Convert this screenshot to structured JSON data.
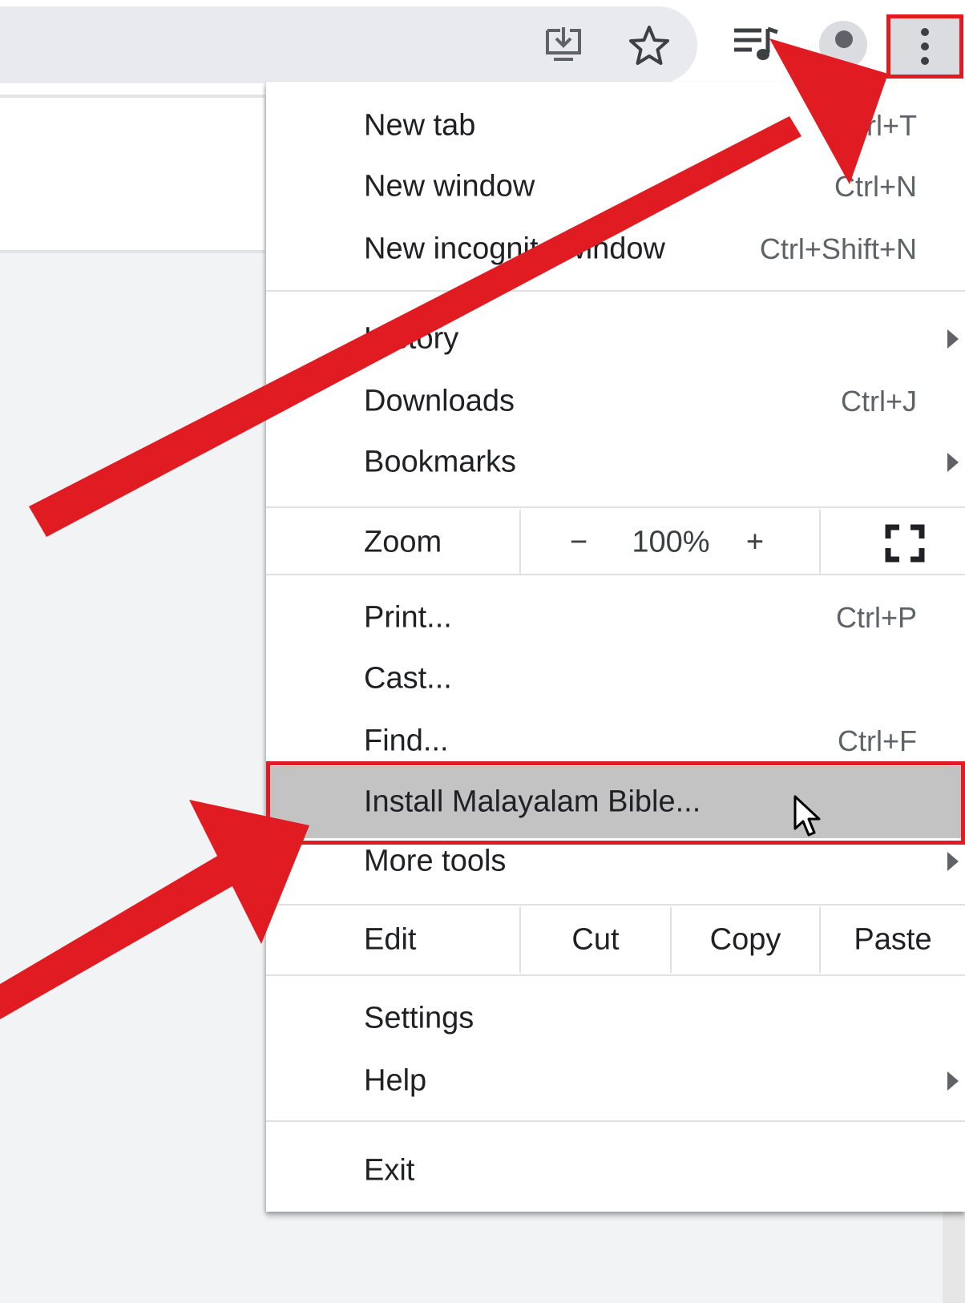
{
  "toolbar": {
    "icons": [
      "install-app-icon",
      "bookmark-star-icon",
      "media-controls-icon",
      "avatar",
      "kebab-menu-icon"
    ]
  },
  "menu": {
    "items": [
      {
        "label": "New tab",
        "shortcut": "Ctrl+T"
      },
      {
        "label": "New window",
        "shortcut": "Ctrl+N"
      },
      {
        "label": "New incognito window",
        "shortcut": "Ctrl+Shift+N"
      },
      {
        "label": "History",
        "submenu": true
      },
      {
        "label": "Downloads",
        "shortcut": "Ctrl+J"
      },
      {
        "label": "Bookmarks",
        "submenu": true
      },
      {
        "label": "Print...",
        "shortcut": "Ctrl+P"
      },
      {
        "label": "Cast..."
      },
      {
        "label": "Find...",
        "shortcut": "Ctrl+F"
      },
      {
        "label": "Install Malayalam Bible...",
        "highlighted": true
      },
      {
        "label": "More tools",
        "submenu": true
      },
      {
        "label": "Settings"
      },
      {
        "label": "Help",
        "submenu": true
      },
      {
        "label": "Exit"
      }
    ],
    "zoom": {
      "label": "Zoom",
      "minus": "−",
      "value": "100%",
      "plus": "+",
      "fullscreen_icon": "fullscreen-icon"
    },
    "edit": {
      "label": "Edit",
      "cut": "Cut",
      "copy": "Copy",
      "paste": "Paste"
    }
  },
  "colors": {
    "annotation_red": "#e01b22",
    "highlight_gray": "#c3c3c3"
  }
}
